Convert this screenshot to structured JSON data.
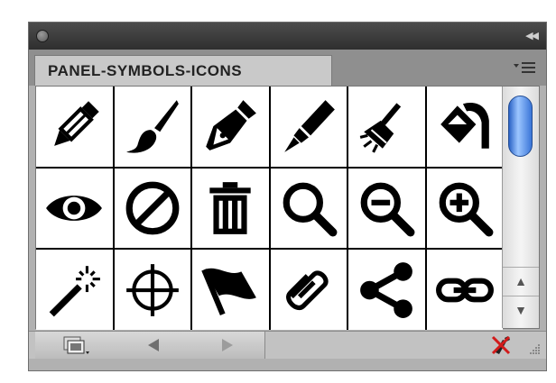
{
  "panel": {
    "tab_label": "PANEL-SYMBOLS-ICONS"
  },
  "symbols": [
    {
      "name": "pencil"
    },
    {
      "name": "paintbrush"
    },
    {
      "name": "fountain-pen"
    },
    {
      "name": "marker"
    },
    {
      "name": "broom"
    },
    {
      "name": "paint-bucket"
    },
    {
      "name": "eye"
    },
    {
      "name": "prohibited"
    },
    {
      "name": "trash"
    },
    {
      "name": "magnifier"
    },
    {
      "name": "zoom-out"
    },
    {
      "name": "zoom-in"
    },
    {
      "name": "magic-wand"
    },
    {
      "name": "crosshair"
    },
    {
      "name": "flag"
    },
    {
      "name": "paperclip"
    },
    {
      "name": "share"
    },
    {
      "name": "link"
    }
  ],
  "colors": {
    "panel_bg": "#b1b1b1",
    "titlebar": "#3a3a3a",
    "scroll_thumb": "#3a75d8",
    "broken_link_red": "#d21b1b"
  }
}
